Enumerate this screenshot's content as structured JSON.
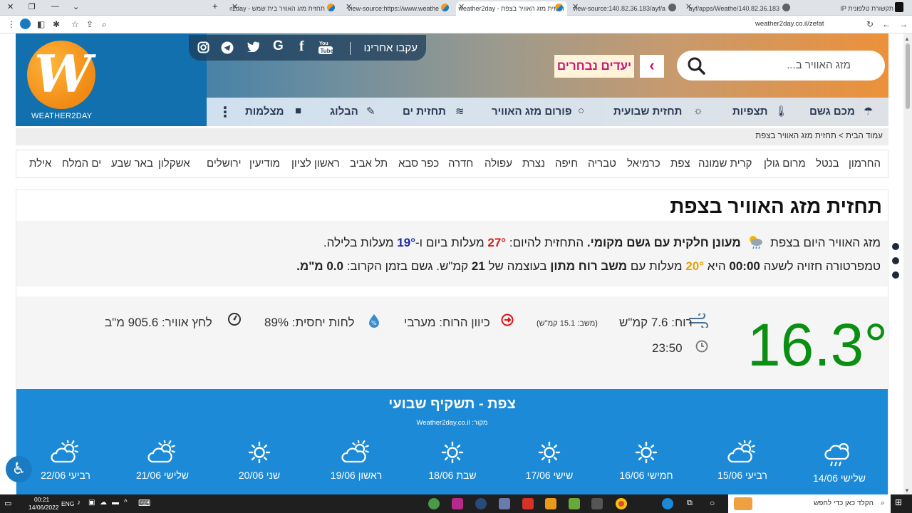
{
  "browser": {
    "tabs": [
      {
        "title": "תקשורת טלפונית IP"
      },
      {
        "title": "140.82.36.183/ayf/apps/Weathe"
      },
      {
        "title": "view-source:140.82.36.183/ayf/a"
      },
      {
        "title": "תחזית מזג האוויר בצפת - weather2day"
      },
      {
        "title": "view-source:https://www.weathe"
      },
      {
        "title": "תחזית מזג האוויר בית שמש - weather2day"
      }
    ],
    "new_tab_label": "+",
    "url": "weather2day.co.il/zefat"
  },
  "header": {
    "logo_text": "WEATHER2DAY",
    "logo_letter": "W",
    "follow_label": "עקבו אחרינו",
    "search_placeholder": "מזג האוויר ב...",
    "chosen_label": "יעדים נבחרים",
    "chevron": "‹",
    "nav": [
      {
        "label": "מכם גשם",
        "icon": "umbrella-icon"
      },
      {
        "label": "תצפיות",
        "icon": "thermometer-icon"
      },
      {
        "label": "תחזית שבועית",
        "icon": "sun-cloud-icon"
      },
      {
        "label": "פורום מזג האוויר",
        "icon": "chat-icon"
      },
      {
        "label": "תחזית ים",
        "icon": "wave-icon"
      },
      {
        "label": "הבלוג",
        "icon": "pencil-icon"
      },
      {
        "label": "מצלמות",
        "icon": "camera-icon"
      }
    ]
  },
  "breadcrumb": "עמוד הבית > תחזית מזג האוויר בצפת",
  "cities": [
    "החרמון",
    "בנטל",
    "מרום גולן",
    "קרית שמונה",
    "צפת",
    "כרמיאל",
    "טבריה",
    "חיפה",
    "נצרת",
    "עפולה",
    "חדרה",
    "כפר סבא",
    "תל אביב",
    "ראשון לציון",
    "מודיעין",
    "ירושלים",
    "אשקלון",
    "באר שבע",
    "ים המלח",
    "אילת"
  ],
  "forecast": {
    "title": "תחזית מזג האוויר בצפת",
    "line1_prefix": "מזג האוויר היום בצפת",
    "line1_condition": "מעונן חלקית עם גשם מקומי.",
    "line1_mid": "התחזית להיום:",
    "day_temp": "27°",
    "line1_and": "מעלות ביום ו-",
    "night_temp": "19°",
    "line1_suffix": "מעלות בלילה.",
    "line2_prefix": "טמפרטורה חזויה לשעה",
    "line2_hour": "00:00",
    "line2_is": "היא",
    "line2_temp": "20°",
    "line2_deg": "מעלות עם",
    "line2_wind": "משב רוח מתון",
    "line2_strength": "בעוצמה של",
    "line2_wind_val": "21",
    "line2_kmh": "קמ\"ש. גשם בזמן הקרוב:",
    "line2_rain": "0.0 מ\"מ."
  },
  "current": {
    "temperature": "16.3°",
    "wind": "רוח: 7.6 קמ\"ש",
    "gust": "(משב: 15.1 קמ\"ש)",
    "wind_dir": "כיוון הרוח: מערבי",
    "humidity": "לחות יחסית: 89%",
    "pressure": "לחץ אוויר: 905.6 מ\"ב",
    "time": "23:50"
  },
  "weekly": {
    "title": "צפת - תשקיף שבועי",
    "source": "מקור: Weather2day.co.il",
    "days": [
      {
        "label": "שלישי 14/06",
        "icon": "rain-cloud-icon"
      },
      {
        "label": "רביעי 15/06",
        "icon": "partly-cloudy-icon"
      },
      {
        "label": "חמישי 16/06",
        "icon": "sun-icon"
      },
      {
        "label": "שישי 17/06",
        "icon": "sun-icon"
      },
      {
        "label": "שבת 18/06",
        "icon": "sun-icon"
      },
      {
        "label": "ראשון 19/06",
        "icon": "partly-cloudy-icon"
      },
      {
        "label": "שני 20/06",
        "icon": "sun-icon"
      },
      {
        "label": "שלישי 21/06",
        "icon": "partly-cloudy-icon"
      },
      {
        "label": "רביעי 22/06",
        "icon": "partly-cloudy-icon"
      }
    ]
  },
  "taskbar": {
    "search_placeholder": "הקלד כאן כדי לחפש",
    "time": "00:21",
    "date": "14/06/2022",
    "lang": "ENG"
  }
}
